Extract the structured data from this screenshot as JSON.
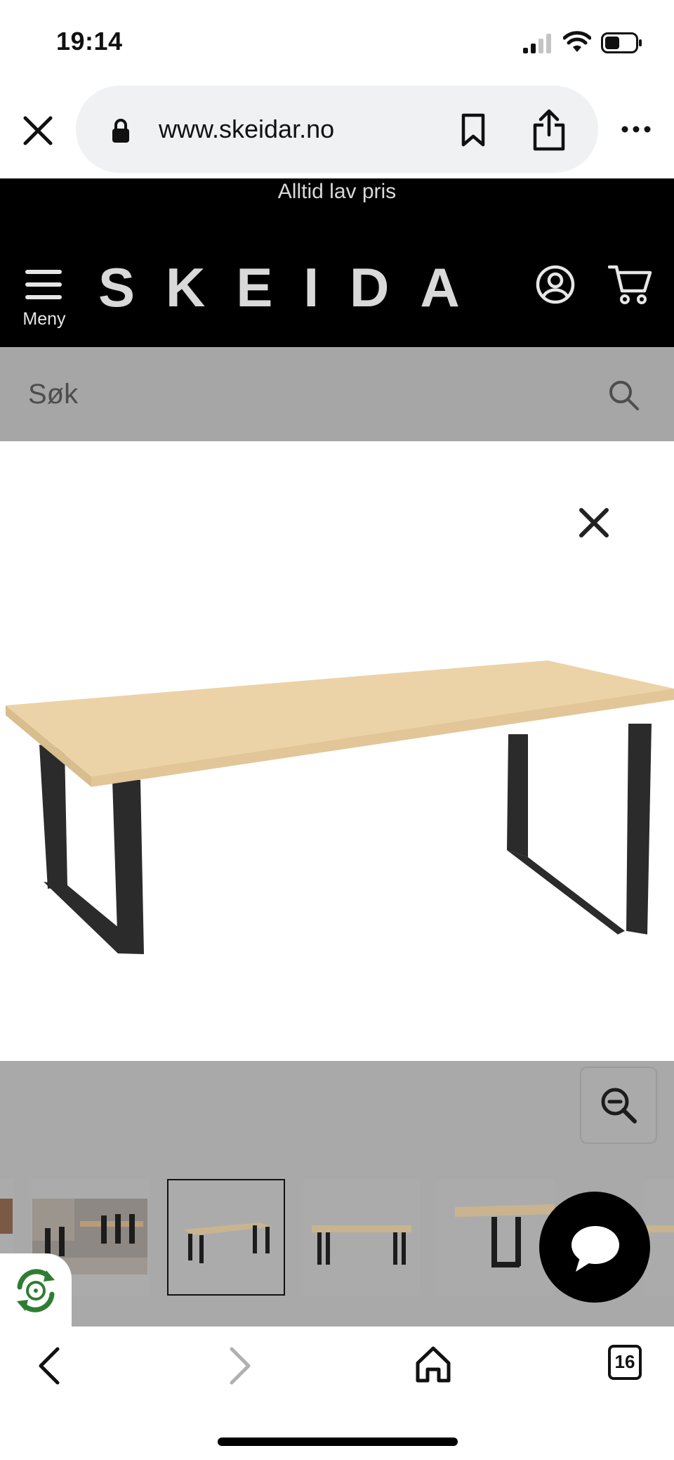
{
  "status_bar": {
    "time": "19:14"
  },
  "browser": {
    "url": "www.skeidar.no",
    "tab_count": "16"
  },
  "site": {
    "promo": "Alltid lav pris",
    "logo": "SKEIDAR",
    "menu_label": "Meny",
    "search_placeholder": "Søk"
  },
  "colors": {
    "header_bg": "#000000",
    "logo": "#d9d9d9",
    "search_bg": "#a6a6a6",
    "overlay_bg": "#a9a9a9",
    "tabletop": "#ecd3a7",
    "table_legs": "#2b2b2b"
  },
  "gallery": {
    "thumbnail_count": 6,
    "selected_index": 2
  },
  "icons": {
    "close_tab": "close-icon",
    "lock": "lock-icon",
    "bookmark": "bookmark-icon",
    "share": "share-icon",
    "more": "more-icon",
    "menu": "hamburger-icon",
    "account": "account-icon",
    "cart": "cart-icon",
    "search": "search-icon",
    "viewer_close": "close-icon",
    "zoom": "zoom-out-icon",
    "chat": "chat-icon",
    "eco": "recycle-icon",
    "back": "chevron-left-icon",
    "forward": "chevron-right-icon",
    "home": "home-icon"
  }
}
